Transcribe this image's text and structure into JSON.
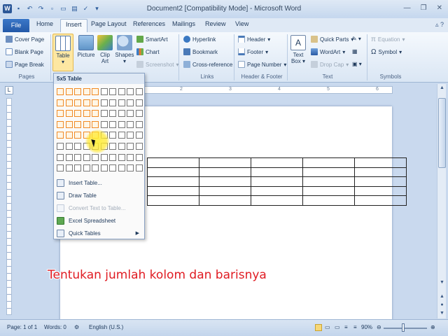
{
  "window": {
    "title": "Document2 [Compatibility Mode] - Microsoft Word",
    "controls": [
      "minimize-icon",
      "restore-icon",
      "close-icon"
    ]
  },
  "tabs": {
    "file": "File",
    "items": [
      "Home",
      "Insert",
      "Page Layout",
      "References",
      "Mailings",
      "Review",
      "View"
    ],
    "active": "Insert"
  },
  "ribbon": {
    "pages": {
      "cover_page": "Cover Page",
      "blank_page": "Blank Page",
      "page_break": "Page Break",
      "label": "Pages"
    },
    "tables": {
      "table": "Table"
    },
    "illustrations": {
      "picture": "Picture",
      "clip_art_1": "Clip",
      "clip_art_2": "Art",
      "shapes": "Shapes",
      "smartart": "SmartArt",
      "chart": "Chart",
      "screenshot": "Screenshot"
    },
    "links": {
      "hyperlink": "Hyperlink",
      "bookmark": "Bookmark",
      "cross_reference": "Cross-reference",
      "label": "Links"
    },
    "header_footer": {
      "header": "Header",
      "footer": "Footer",
      "page_number": "Page Number",
      "label": "Header & Footer"
    },
    "text": {
      "text_box_1": "Text",
      "text_box_2": "Box",
      "quick_parts": "Quick Parts",
      "wordart": "WordArt",
      "drop_cap": "Drop Cap",
      "label": "Text"
    },
    "symbols": {
      "equation": "Equation",
      "symbol": "Symbol",
      "label": "Symbols"
    }
  },
  "table_dropdown": {
    "header": "5x5 Table",
    "grid_cols": 10,
    "grid_rows": 8,
    "selected_cols": 5,
    "selected_rows": 5,
    "menu": {
      "insert_table": "Insert Table...",
      "draw_table": "Draw Table",
      "convert_text": "Convert Text to Table...",
      "excel_spreadsheet": "Excel Spreadsheet",
      "quick_tables": "Quick Tables"
    }
  },
  "document": {
    "table_rows": 5,
    "table_cols": 5
  },
  "caption": "Tentukan jumlah kolom dan barisnya",
  "status": {
    "page": "Page: 1 of 1",
    "words": "Words: 0",
    "language": "English (U.S.)",
    "zoom": "90%"
  },
  "colors": {
    "accent": "#2b5797",
    "selection_border": "#f08a24",
    "caption": "#e01b22"
  }
}
